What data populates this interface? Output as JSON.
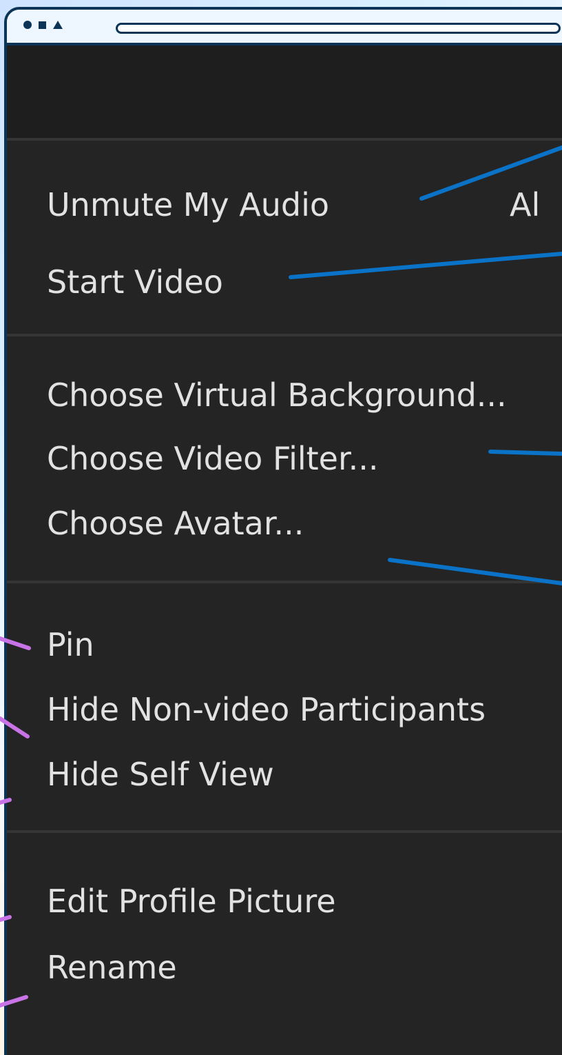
{
  "menu": {
    "items": [
      {
        "label": "Unmute My Audio",
        "shortcut": "Al"
      },
      {
        "label": "Start Video"
      },
      {
        "label": "Choose Virtual Background..."
      },
      {
        "label": "Choose Video Filter..."
      },
      {
        "label": "Choose Avatar..."
      },
      {
        "label": "Pin"
      },
      {
        "label": "Hide Non-video Participants"
      },
      {
        "label": "Hide Self View"
      },
      {
        "label": "Edit Profile Picture"
      },
      {
        "label": "Rename"
      }
    ]
  },
  "colors": {
    "menu_background": "#242424",
    "menu_text": "#e2e2e2",
    "divider": "#353535",
    "frame_border": "#0b3456",
    "callout_blue": "#0a73c8",
    "callout_purple": "#c873e6"
  },
  "icons": [
    "circle-icon",
    "square-icon",
    "triangle-icon"
  ]
}
